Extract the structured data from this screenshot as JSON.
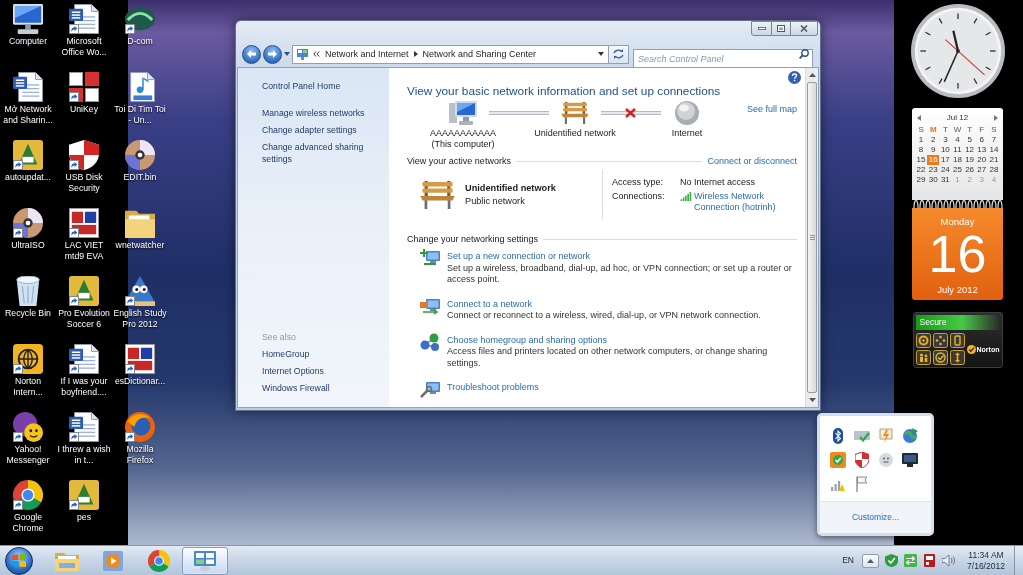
{
  "desktop": {
    "icons": [
      {
        "label": "Computer",
        "kind": "computer",
        "shortcut": false
      },
      {
        "label": "Mở Network and Sharin...",
        "kind": "document",
        "shortcut": false
      },
      {
        "label": "autoupdat...",
        "kind": "game",
        "shortcut": true
      },
      {
        "label": "UltraISO",
        "kind": "disc",
        "shortcut": true
      },
      {
        "label": "Recycle Bin",
        "kind": "bin",
        "shortcut": false
      },
      {
        "label": "Norton Intern...",
        "kind": "globe",
        "shortcut": true
      },
      {
        "label": "Yahoo! Messenger",
        "kind": "messenger",
        "shortcut": true
      },
      {
        "label": "Google Chrome",
        "kind": "chrome",
        "shortcut": true
      },
      {
        "label": "Microsoft Office Wo...",
        "kind": "document",
        "shortcut": true
      },
      {
        "label": "UniKey",
        "kind": "keys",
        "shortcut": true
      },
      {
        "label": "USB Disk Security",
        "kind": "shield",
        "shortcut": true
      },
      {
        "label": "LAC VIET mtd9 EVA",
        "kind": "dictionary",
        "shortcut": true
      },
      {
        "label": "Pro Evolution Soccer 6",
        "kind": "game",
        "shortcut": true
      },
      {
        "label": "If I was your boyfriend....",
        "kind": "document",
        "shortcut": true
      },
      {
        "label": "I threw a wish in t...",
        "kind": "document",
        "shortcut": true
      },
      {
        "label": "pes",
        "kind": "game",
        "shortcut": true
      },
      {
        "label": "D-com",
        "kind": "dcom",
        "shortcut": true
      },
      {
        "label": "Toi Di Tim Toi - Un...",
        "kind": "audio",
        "shortcut": false
      },
      {
        "label": "EDIT.bin",
        "kind": "disc",
        "shortcut": false
      },
      {
        "label": "wnetwatcher",
        "kind": "folder",
        "shortcut": false
      },
      {
        "label": "English Study Pro 2012",
        "kind": "mascot",
        "shortcut": true
      },
      {
        "label": "esDictionar...",
        "kind": "dictionary",
        "shortcut": true
      },
      {
        "label": "Mozilla Firefox",
        "kind": "firefox",
        "shortcut": true
      }
    ]
  },
  "window": {
    "address": {
      "breadcrumb": [
        "Network and Internet",
        "Network and Sharing Center"
      ]
    },
    "search": {
      "placeholder": "Search Control Panel"
    },
    "sidebar": {
      "links": [
        "Control Panel Home",
        "Manage wireless networks",
        "Change adapter settings",
        "Change advanced sharing settings"
      ],
      "see_also": {
        "heading": "See also",
        "links": [
          "HomeGroup",
          "Internet Options",
          "Windows Firewall"
        ]
      }
    },
    "main": {
      "title": "View your basic network information and set up connections",
      "network_map": {
        "nodes": [
          {
            "kind": "computer",
            "label": "AAAAAAAAAAA",
            "sublabel": "(This computer)"
          },
          {
            "kind": "network",
            "label": "Unidentified network"
          },
          {
            "kind": "internet",
            "label": "Internet"
          }
        ],
        "links": [
          {
            "broken": false
          },
          {
            "broken": true
          }
        ],
        "full_map_link": "See full map"
      },
      "active_networks": {
        "heading": "View your active networks",
        "action_link": "Connect or disconnect",
        "networks": [
          {
            "name": "Unidentified network",
            "category": "Public network",
            "access_type_label": "Access type:",
            "access_type": "No Internet access",
            "connections_label": "Connections:",
            "connection": "Wireless Network Connection (hotrinh)"
          }
        ]
      },
      "settings": {
        "heading": "Change your networking settings",
        "tasks": [
          {
            "kind": "new-connection",
            "title": "Set up a new connection or network",
            "description": "Set up a wireless, broadband, dial-up, ad hoc, or VPN connection; or set up a router or access point."
          },
          {
            "kind": "connect",
            "title": "Connect to a network",
            "description": "Connect or reconnect to a wireless, wired, dial-up, or VPN network connection."
          },
          {
            "kind": "homegroup",
            "title": "Choose homegroup and sharing options",
            "description": "Access files and printers located on other network computers, or change sharing settings."
          },
          {
            "kind": "troubleshoot",
            "title": "Troubleshoot problems"
          }
        ]
      }
    }
  },
  "gadgets": {
    "calendar": {
      "month": "Jul 12",
      "weekdays": [
        {
          "label": "S",
          "selected": false
        },
        {
          "label": "M",
          "selected": true
        },
        {
          "label": "T",
          "selected": false
        },
        {
          "label": "W",
          "selected": false
        },
        {
          "label": "T",
          "selected": false
        },
        {
          "label": "F",
          "selected": false
        },
        {
          "label": "S",
          "selected": false
        }
      ],
      "weeks": [
        [
          {
            "day": "1",
            "selected": false,
            "dim": false
          },
          {
            "day": "2",
            "selected": false,
            "dim": false
          },
          {
            "day": "3",
            "selected": false,
            "dim": false
          },
          {
            "day": "4",
            "selected": false,
            "dim": false
          },
          {
            "day": "5",
            "selected": false,
            "dim": false
          },
          {
            "day": "6",
            "selected": false,
            "dim": false
          },
          {
            "day": "7",
            "selected": false,
            "dim": false
          }
        ],
        [
          {
            "day": "8",
            "selected": false,
            "dim": false
          },
          {
            "day": "9",
            "selected": false,
            "dim": false
          },
          {
            "day": "10",
            "selected": false,
            "dim": false
          },
          {
            "day": "11",
            "selected": false,
            "dim": false
          },
          {
            "day": "12",
            "selected": false,
            "dim": false
          },
          {
            "day": "13",
            "selected": false,
            "dim": false
          },
          {
            "day": "14",
            "selected": false,
            "dim": false
          }
        ],
        [
          {
            "day": "15",
            "selected": false,
            "dim": false
          },
          {
            "day": "16",
            "selected": true,
            "dim": false
          },
          {
            "day": "17",
            "selected": false,
            "dim": false
          },
          {
            "day": "18",
            "selected": false,
            "dim": false
          },
          {
            "day": "19",
            "selected": false,
            "dim": false
          },
          {
            "day": "20",
            "selected": false,
            "dim": false
          },
          {
            "day": "21",
            "selected": false,
            "dim": false
          }
        ],
        [
          {
            "day": "22",
            "selected": false,
            "dim": false
          },
          {
            "day": "23",
            "selected": false,
            "dim": false
          },
          {
            "day": "24",
            "selected": false,
            "dim": false
          },
          {
            "day": "25",
            "selected": false,
            "dim": false
          },
          {
            "day": "26",
            "selected": false,
            "dim": false
          },
          {
            "day": "27",
            "selected": false,
            "dim": false
          },
          {
            "day": "28",
            "selected": false,
            "dim": false
          }
        ],
        [
          {
            "day": "29",
            "selected": false,
            "dim": false
          },
          {
            "day": "30",
            "selected": false,
            "dim": false
          },
          {
            "day": "31",
            "selected": false,
            "dim": false
          },
          {
            "day": "1",
            "selected": false,
            "dim": true
          },
          {
            "day": "2",
            "selected": false,
            "dim": true
          },
          {
            "day": "3",
            "selected": false,
            "dim": true
          },
          {
            "day": "4",
            "selected": false,
            "dim": true
          }
        ]
      ],
      "day_name": "Monday",
      "day_number": "16",
      "month_year": "July 2012"
    },
    "security": {
      "status": "Secure",
      "brand": "Norton"
    }
  },
  "tray_overflow": {
    "customize_link": "Customize..."
  },
  "taskbar": {
    "apps": [
      {
        "kind": "explorer",
        "selected": false
      },
      {
        "kind": "media-player",
        "selected": false
      },
      {
        "kind": "chrome",
        "selected": false
      },
      {
        "kind": "control-panel",
        "selected": true
      }
    ],
    "language": "EN",
    "time": "11:34 AM",
    "date": "7/16/2012"
  }
}
